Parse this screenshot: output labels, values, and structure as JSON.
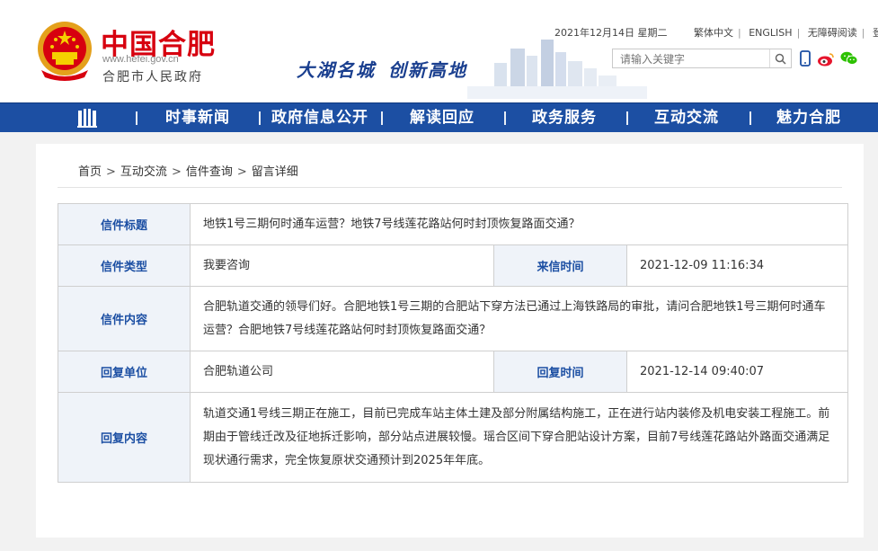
{
  "header": {
    "site_title": "中国合肥",
    "site_url": "www.hefei.gov.cn",
    "site_subtitle": "合肥市人民政府",
    "slogan_part1": "大湖名城",
    "slogan_part2": "创新高地",
    "date": "2021年12月14日 星期二",
    "links": [
      "繁体中文",
      "ENGLISH",
      "无障碍阅读",
      "登录"
    ],
    "search_placeholder": "请输入关键字",
    "icons": [
      "mobile-icon",
      "weibo-icon",
      "wechat-icon"
    ]
  },
  "nav": {
    "items": [
      "时事新闻",
      "政府信息公开",
      "解读回应",
      "政务服务",
      "互动交流",
      "魅力合肥"
    ]
  },
  "breadcrumb": [
    "首页",
    "互动交流",
    "信件查询",
    "留言详细"
  ],
  "letter": {
    "title_label": "信件标题",
    "title_value": "地铁1号三期何时通车运营？地铁7号线莲花路站何时封顶恢复路面交通？",
    "type_label": "信件类型",
    "type_value": "我要咨询",
    "time_label": "来信时间",
    "time_value": "2021-12-09 11:16:34",
    "content_label": "信件内容",
    "content_value": "合肥轨道交通的领导们好。合肥地铁1号三期的合肥站下穿方法已通过上海铁路局的审批，请问合肥地铁1号三期何时通车运营？合肥地铁7号线莲花路站何时封顶恢复路面交通？",
    "reply_unit_label": "回复单位",
    "reply_unit_value": "合肥轨道公司",
    "reply_time_label": "回复时间",
    "reply_time_value": "2021-12-14 09:40:07",
    "reply_content_label": "回复内容",
    "reply_content_value": "轨道交通1号线三期正在施工，目前已完成车站主体土建及部分附属结构施工，正在进行站内装修及机电安装工程施工。前期由于管线迁改及征地拆迁影响，部分站点进展较慢。瑶合区间下穿合肥站设计方案，目前7号线莲花路站外路面交通满足现状通行需求，完全恢复原状交通预计到2025年年底。"
  },
  "colors": {
    "brand_red": "#d7000f",
    "nav_blue": "#1c4fa3",
    "label_bg": "#eff3f9"
  }
}
